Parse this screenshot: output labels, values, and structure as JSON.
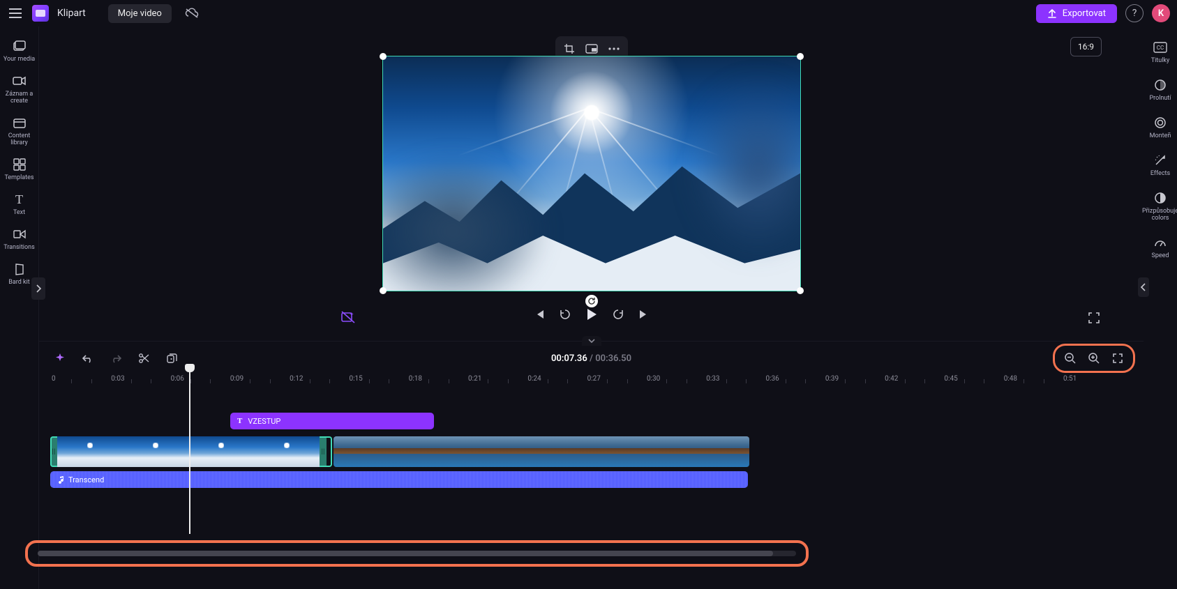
{
  "header": {
    "app_name": "Klipart",
    "project_name": "Moje video",
    "export_label": "Exportovat",
    "avatar_initial": "K",
    "aspect_label": "16:9"
  },
  "left_rail": {
    "items": [
      {
        "id": "your-media",
        "label": "Your media"
      },
      {
        "id": "record-create",
        "label": "Záznam a create"
      },
      {
        "id": "content-lib",
        "label": "Content library"
      },
      {
        "id": "templates",
        "label": "Templates"
      },
      {
        "id": "text",
        "label": "Text"
      },
      {
        "id": "transitions",
        "label": "Transitions"
      },
      {
        "id": "bard-kit",
        "label": "Bard kit"
      }
    ]
  },
  "right_rail": {
    "items": [
      {
        "id": "titulky",
        "label": "Titulky"
      },
      {
        "id": "prolnuti",
        "label": "Prolnutí"
      },
      {
        "id": "montent",
        "label": "Monteñ"
      },
      {
        "id": "effects",
        "label": "Effects"
      },
      {
        "id": "colors",
        "label": "Přizpůsobuje colors"
      },
      {
        "id": "speed",
        "label": "Speed"
      }
    ]
  },
  "transport": {
    "current_time": "00:07.36",
    "duration": "00:36.50"
  },
  "timeline": {
    "ruler_marks": [
      "0",
      "0:03",
      "0:06",
      "0:09",
      "0:12",
      "0:15",
      "0:18",
      "0:21",
      "0:24",
      "0:27",
      "0:30",
      "0:33",
      "0:36",
      "0:39",
      "0:42",
      "0:45",
      "0:48",
      "0:51"
    ],
    "text_clip_label": "VZESTUP",
    "audio_clip_label": "Transcend"
  }
}
